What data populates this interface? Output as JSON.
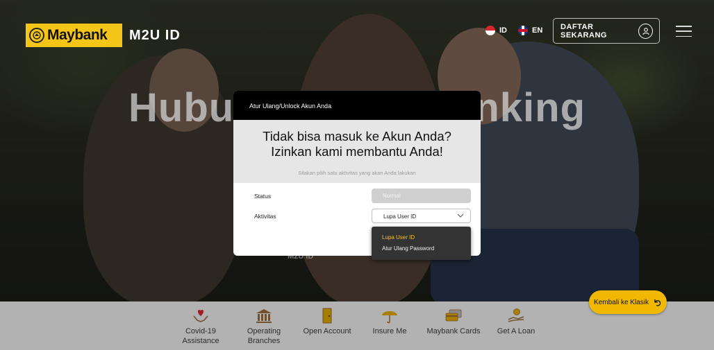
{
  "hero": {
    "title": "Hubungi Kami Banking",
    "bg_label": "M2U ID"
  },
  "header": {
    "brand_name": "Maybank",
    "app_name": "M2U ID",
    "lang_id": "ID",
    "lang_en": "EN",
    "signup_label": "DAFTAR SEKARANG",
    "icons": [
      "maybank-tiger-icon",
      "flag-id-icon",
      "flag-uk-icon",
      "user-icon",
      "hamburger-menu-icon"
    ]
  },
  "modal": {
    "header_title": "Atur Ulang/Unlock Akun Anda",
    "title_line1": "Tidak bisa masuk ke Akun Anda?",
    "title_line2": "Izinkan kami membantu Anda!",
    "subtitle": "Silakan pilih satu aktivitas yang akan Anda lakukan",
    "status_label": "Status",
    "status_value": "Normal",
    "activity_label": "Aktivitas",
    "activity_value": "Lupa User ID",
    "activity_options": [
      "Lupa User ID",
      "Atur Ulang Password"
    ]
  },
  "quickbar": {
    "items": [
      {
        "line1": "Covid-19",
        "line2": "Assistance",
        "icon": "heart-hands-icon"
      },
      {
        "line1": "Operating",
        "line2": "Branches",
        "icon": "bank-building-icon"
      },
      {
        "line1": "Open Account",
        "line2": "",
        "icon": "door-icon"
      },
      {
        "line1": "Insure Me",
        "line2": "",
        "icon": "umbrella-icon"
      },
      {
        "line1": "Maybank Cards",
        "line2": "",
        "icon": "cards-icon"
      },
      {
        "line1": "Get A Loan",
        "line2": "",
        "icon": "money-hand-icon"
      }
    ]
  },
  "back_classic": {
    "label": "Kembali ke Klasik",
    "icon": "undo-arrow-icon"
  },
  "colors": {
    "brand_yellow": "#f5c518",
    "button_yellow": "#f0b800",
    "dropdown_active": "#f3c138",
    "modal_header": "#000000"
  }
}
